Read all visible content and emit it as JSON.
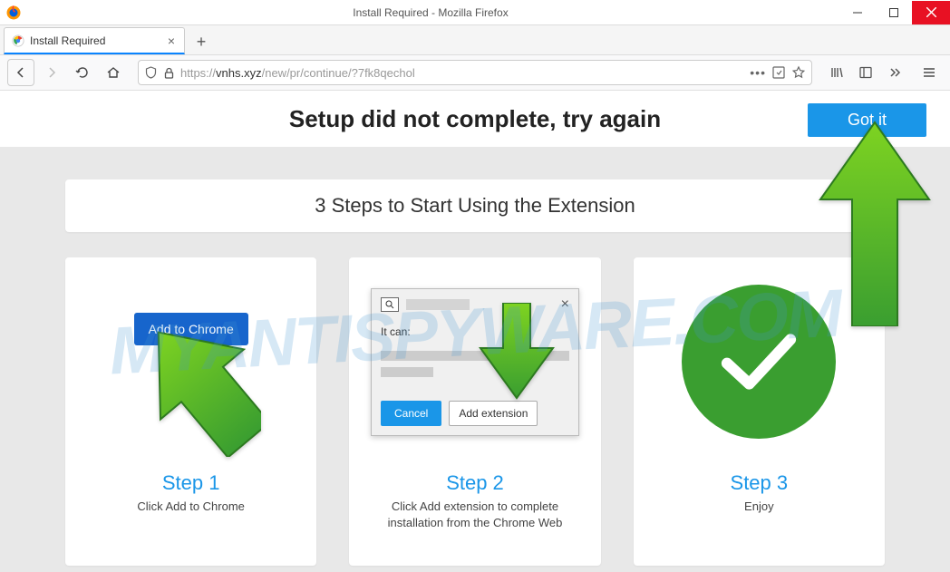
{
  "window": {
    "title": "Install Required - Mozilla Firefox"
  },
  "tab": {
    "title": "Install Required"
  },
  "url": {
    "protocol": "https://",
    "domain": "vnhs.xyz",
    "path": "/new/pr/continue/?7fk8qechol"
  },
  "banner": {
    "heading": "Setup did not complete, try again",
    "got_it": "Got it"
  },
  "subtitle": "3 Steps to Start Using the Extension",
  "step1": {
    "button": "Add to Chrome",
    "title": "Step 1",
    "desc": "Click Add to Chrome"
  },
  "step2": {
    "it_can": "It can:",
    "cancel": "Cancel",
    "add_ext": "Add extension",
    "title": "Step 2",
    "desc": "Click Add extension to complete installation from the Chrome Web"
  },
  "step3": {
    "title": "Step 3",
    "desc": "Enjoy"
  },
  "watermark": "MYANTISPYWARE.COM"
}
